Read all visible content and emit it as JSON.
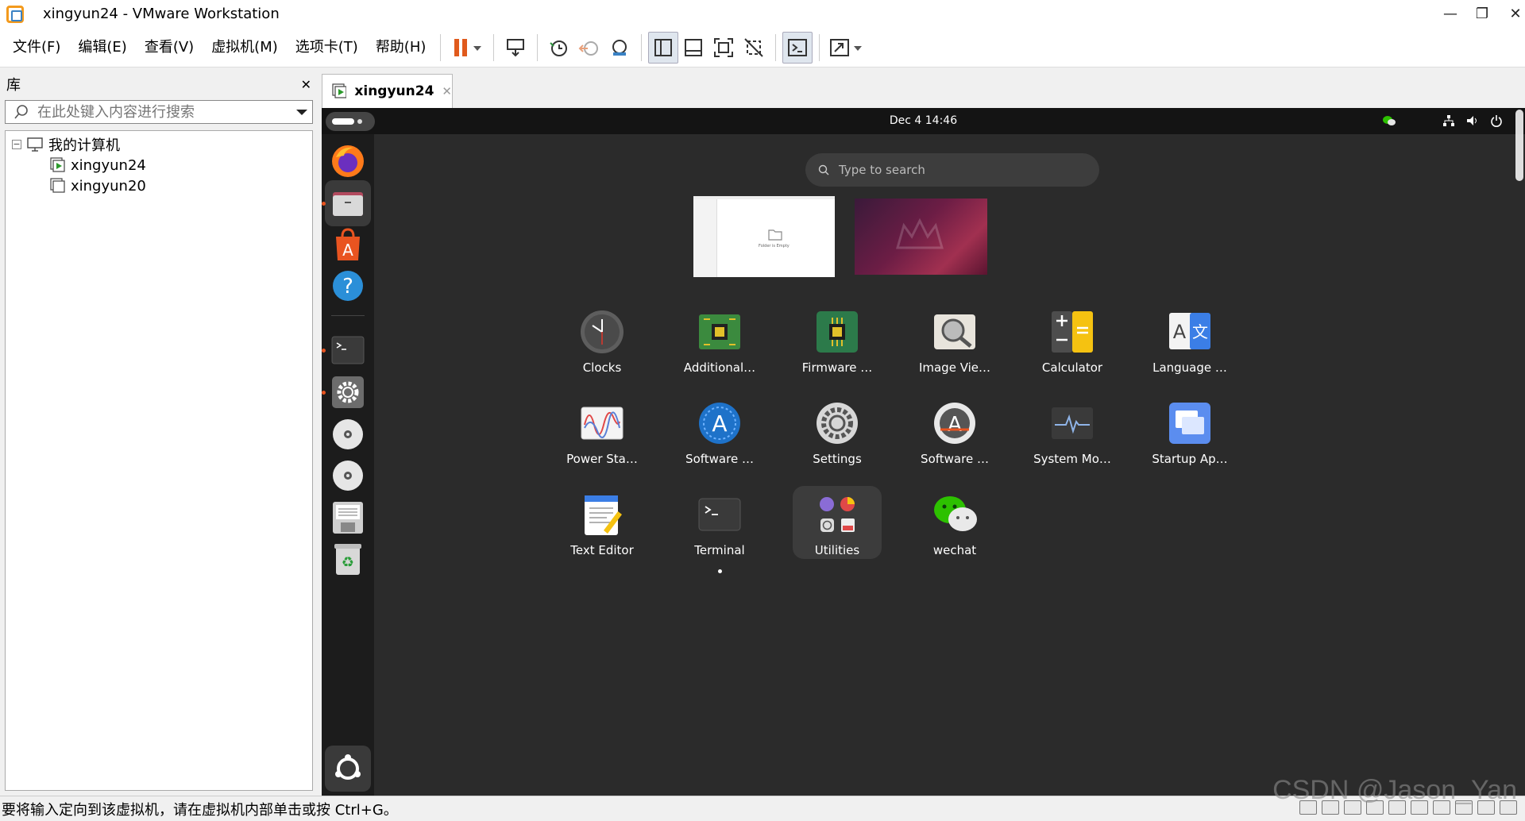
{
  "window": {
    "title": "xingyun24 - VMware Workstation",
    "minimize": "—",
    "maximize": "❐",
    "close": "✕"
  },
  "menu": [
    "文件(F)",
    "编辑(E)",
    "查看(V)",
    "虚拟机(M)",
    "选项卡(T)",
    "帮助(H)"
  ],
  "library": {
    "title": "库",
    "close": "✕",
    "search_placeholder": "在此处键入内容进行搜索",
    "root": "我的计算机",
    "vms": [
      "xingyun24",
      "xingyun20"
    ],
    "expand_glyph": "−"
  },
  "tab": {
    "label": "xingyun24",
    "close": "✕"
  },
  "guest": {
    "clock": "Dec 4  14:46",
    "search_placeholder": "Type to search",
    "thumb_text": "Folder is Empty",
    "apps": [
      {
        "label": "Clocks",
        "icon": "clocks-icon"
      },
      {
        "label": "Additional…",
        "icon": "additional-drivers-icon"
      },
      {
        "label": "Firmware …",
        "icon": "firmware-icon"
      },
      {
        "label": "Image Vie…",
        "icon": "image-viewer-icon"
      },
      {
        "label": "Calculator",
        "icon": "calculator-icon"
      },
      {
        "label": "Language …",
        "icon": "language-icon"
      },
      {
        "label": "Power Sta…",
        "icon": "power-statistics-icon"
      },
      {
        "label": "Software …",
        "icon": "software-updater-icon"
      },
      {
        "label": "Settings",
        "icon": "settings-icon"
      },
      {
        "label": "Software …",
        "icon": "software-properties-icon"
      },
      {
        "label": "System Mo…",
        "icon": "system-monitor-icon"
      },
      {
        "label": "Startup Ap…",
        "icon": "startup-apps-icon"
      },
      {
        "label": "Text Editor",
        "icon": "text-editor-icon"
      },
      {
        "label": "Terminal",
        "icon": "terminal-icon"
      },
      {
        "label": "Utilities",
        "icon": "utilities-folder-icon"
      },
      {
        "label": "wechat",
        "icon": "wechat-icon"
      }
    ]
  },
  "status": {
    "text": "要将输入定向到该虚拟机，请在虚拟机内部单击或按 Ctrl+G。",
    "watermark": "CSDN @Jason_Yan"
  },
  "colors": {
    "ubuntu_orange": "#e95420",
    "vm_accent": "#f39a1d",
    "pause": "#e05a1c"
  }
}
